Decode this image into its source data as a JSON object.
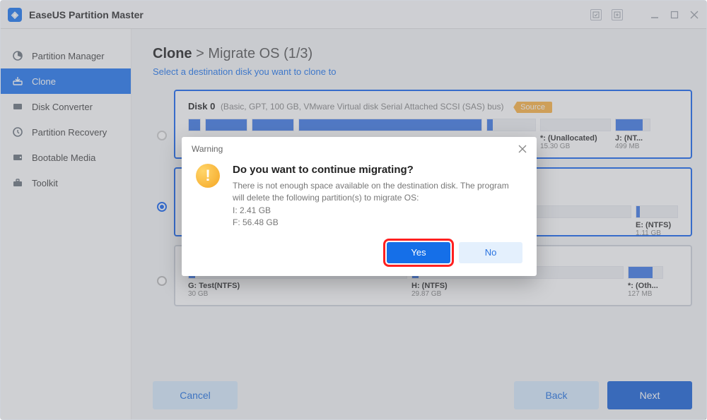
{
  "title": "EaseUS Partition Master",
  "sidebar": {
    "items": [
      {
        "label": "Partition Manager"
      },
      {
        "label": "Clone"
      },
      {
        "label": "Disk Converter"
      },
      {
        "label": "Partition Recovery"
      },
      {
        "label": "Bootable Media"
      },
      {
        "label": "Toolkit"
      }
    ]
  },
  "breadcrumb": {
    "root": "Clone",
    "sep": ">",
    "page": "Migrate OS (1/3)"
  },
  "subtitle": "Select a destination disk you want to clone to",
  "disks": [
    {
      "name": "Disk 0",
      "meta": "(Basic, GPT, 100 GB, VMware   Virtual disk   Serial Attached SCSI (SAS) bus)",
      "source_badge": "Source",
      "partitions_tail": [
        {
          "label": "*: (Unallocated)",
          "size": "15.30 GB"
        },
        {
          "label": "J: (NT...",
          "size": "499 MB"
        }
      ]
    },
    {
      "partitions_tail": [
        {
          "label": "E: (NTFS)",
          "size": "1.11 GB"
        }
      ]
    },
    {
      "partitions": [
        {
          "label": "G: Test(NTFS)",
          "size": "30 GB"
        },
        {
          "label": "H: (NTFS)",
          "size": "29.87 GB"
        },
        {
          "label": "*: (Oth...",
          "size": "127 MB"
        }
      ]
    }
  ],
  "buttons": {
    "cancel": "Cancel",
    "back": "Back",
    "next": "Next"
  },
  "dialog": {
    "title": "Warning",
    "heading": "Do you want to continue migrating?",
    "body1": "There is not enough space available on the destination disk. The program will delete the following partition(s) to migrate OS:",
    "line_i": "I: 2.41 GB",
    "line_f": "F: 56.48 GB",
    "yes": "Yes",
    "no": "No"
  }
}
